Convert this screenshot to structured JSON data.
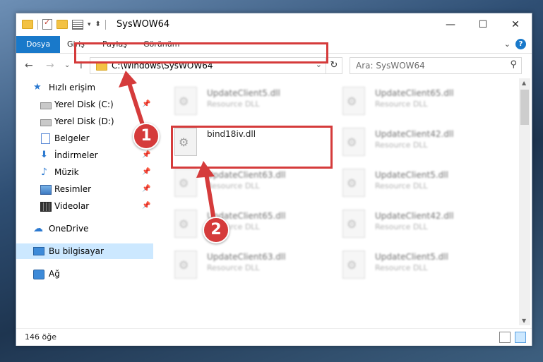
{
  "window": {
    "title": "SysWOW64",
    "minimize": "—",
    "maximize": "☐",
    "close": "✕"
  },
  "ribbon": {
    "tabs": [
      "Dosya",
      "Giriş",
      "Paylaş",
      "Görünüm"
    ],
    "expand": "⌄",
    "help": "?"
  },
  "nav": {
    "back": "←",
    "forward": "→",
    "recent": "⌄",
    "up": "↑",
    "address": "C:\\Windows\\SysWOW64",
    "refresh": "↻",
    "search_placeholder": "Ara: SysWOW64"
  },
  "sidebar": {
    "items": [
      {
        "label": "Hızlı erişim",
        "icon": "star-icon"
      },
      {
        "label": "Yerel Disk (C:)",
        "icon": "disk-icon"
      },
      {
        "label": "Yerel Disk (D:)",
        "icon": "disk-icon"
      },
      {
        "label": "Belgeler",
        "icon": "document-icon"
      },
      {
        "label": "İndirmeler",
        "icon": "download-icon"
      },
      {
        "label": "Müzik",
        "icon": "music-icon"
      },
      {
        "label": "Resimler",
        "icon": "pictures-icon"
      },
      {
        "label": "Videolar",
        "icon": "video-icon"
      },
      {
        "label": "OneDrive",
        "icon": "cloud-icon"
      },
      {
        "label": "Bu bilgisayar",
        "icon": "computer-icon"
      },
      {
        "label": "Ağ",
        "icon": "network-icon"
      }
    ]
  },
  "files": {
    "col1": [
      {
        "name": "UpdateClient5.dll",
        "type": "Resource DLL"
      },
      {
        "name": "bind18iv.dll",
        "type": ""
      },
      {
        "name": "UpdateClient63.dll",
        "type": "Resource DLL"
      },
      {
        "name": "UpdateClient65.dll",
        "type": "Resource DLL"
      },
      {
        "name": "UpdateClient63.dll",
        "type": "Resource DLL"
      }
    ],
    "col2": [
      {
        "name": "UpdateClient65.dll",
        "type": "Resource DLL"
      },
      {
        "name": "UpdateClient42.dll",
        "type": "Resource DLL"
      },
      {
        "name": "UpdateClient5.dll",
        "type": "Resource DLL"
      },
      {
        "name": "UpdateClient42.dll",
        "type": "Resource DLL"
      },
      {
        "name": "UpdateClient5.dll",
        "type": "Resource DLL"
      }
    ]
  },
  "status": {
    "count": "146 öğe"
  },
  "annotations": {
    "step1": "1",
    "step2": "2",
    "color": "#d53b3b"
  }
}
